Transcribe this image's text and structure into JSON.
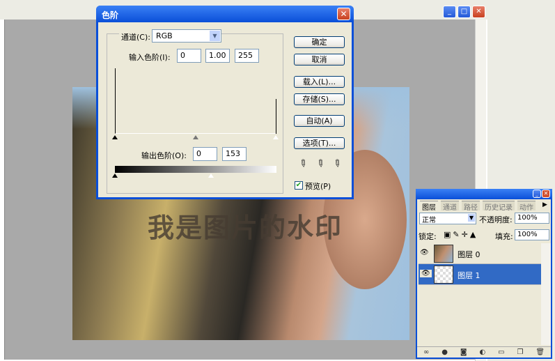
{
  "levels_dialog": {
    "title": "色阶",
    "channel_label": "通道(C):",
    "channel_value": "RGB",
    "input_levels_label": "输入色阶(I):",
    "input_black": "0",
    "input_gamma": "1.00",
    "input_white": "255",
    "output_levels_label": "输出色阶(O):",
    "output_black": "0",
    "output_white": "153",
    "buttons": {
      "ok": "确定",
      "cancel": "取消",
      "load": "载入(L)...",
      "save": "存储(S)...",
      "auto": "自动(A)",
      "options": "选项(T)..."
    },
    "preview_label": "预览(P)",
    "preview_checked": true
  },
  "canvas": {
    "watermark_text": "我是图片的水印"
  },
  "layers_panel": {
    "tabs": [
      "图层",
      "通道",
      "路径",
      "历史记录",
      "动作"
    ],
    "blend_mode": "正常",
    "opacity_label": "不透明度:",
    "opacity_value": "100%",
    "lock_label": "锁定:",
    "fill_label": "填充:",
    "fill_value": "100%",
    "layers": [
      {
        "name": "图层 0",
        "selected": false
      },
      {
        "name": "图层 1",
        "selected": true
      }
    ]
  },
  "colors": {
    "accent": "#0a4fd8",
    "selected_layer": "#316ac5"
  }
}
